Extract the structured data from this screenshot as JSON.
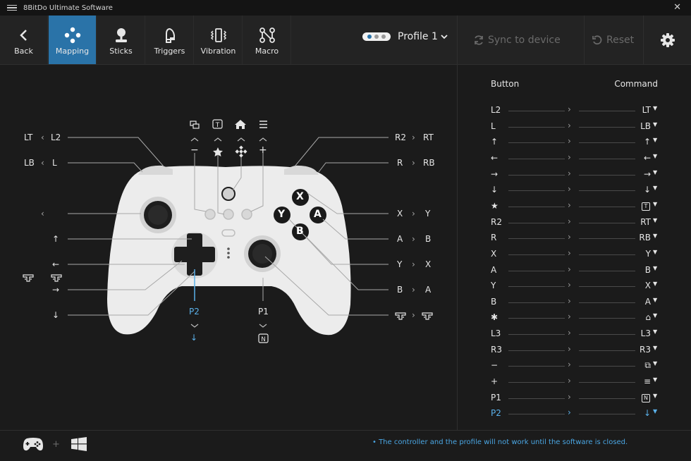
{
  "window": {
    "title": "8BitDo Ultimate Software"
  },
  "toolbar": {
    "nav": [
      {
        "id": "back",
        "label": "Back",
        "icon": "back-arrow-icon"
      },
      {
        "id": "mapping",
        "label": "Mapping",
        "icon": "mapping-dpad-icon",
        "active": true
      },
      {
        "id": "sticks",
        "label": "Sticks",
        "icon": "joystick-icon"
      },
      {
        "id": "triggers",
        "label": "Triggers",
        "icon": "trigger-icon"
      },
      {
        "id": "vibration",
        "label": "Vibration",
        "icon": "vibration-icon"
      },
      {
        "id": "macro",
        "label": "Macro",
        "icon": "macro-icon"
      }
    ],
    "profile_name": "Profile 1",
    "sync_label": "Sync to device",
    "reset_label": "Reset"
  },
  "controller": {
    "left_labels": [
      {
        "from": "LT",
        "to": "L2"
      },
      {
        "from": "LB",
        "to": "L"
      },
      {
        "from": "L3",
        "to": "L3",
        "icon": "left-stick-press-icon"
      },
      {
        "from": "",
        "to": "↑"
      },
      {
        "from": "",
        "to": "←"
      },
      {
        "from": "",
        "to": "→"
      },
      {
        "from": "",
        "to": "↓"
      }
    ],
    "right_labels": [
      {
        "from": "R2",
        "to": "RT"
      },
      {
        "from": "R",
        "to": "RB"
      },
      {
        "from": "X",
        "to": "Y"
      },
      {
        "from": "A",
        "to": "B"
      },
      {
        "from": "Y",
        "to": "X"
      },
      {
        "from": "B",
        "to": "A"
      },
      {
        "from": "R3",
        "to": "R3",
        "icon": "right-stick-press-icon"
      }
    ],
    "face_buttons": {
      "x": "X",
      "y": "Y",
      "a": "A",
      "b": "B"
    },
    "top_minus": "−",
    "top_plus": "+",
    "top_t": "T",
    "p2_label": "P2",
    "p2_arrow": "↓",
    "p1_label": "P1",
    "p1_badge": "N"
  },
  "panel": {
    "header_button": "Button",
    "header_command": "Command",
    "rows": [
      {
        "button": "L2",
        "command": "LT"
      },
      {
        "button": "L",
        "command": "LB"
      },
      {
        "button": "↑",
        "command": "↑"
      },
      {
        "button": "←",
        "command": "←"
      },
      {
        "button": "→",
        "command": "→"
      },
      {
        "button": "↓",
        "command": "↓"
      },
      {
        "button": "★",
        "command": "T",
        "command_boxed": true
      },
      {
        "button": "R2",
        "command": "RT"
      },
      {
        "button": "R",
        "command": "RB"
      },
      {
        "button": "X",
        "command": "Y"
      },
      {
        "button": "A",
        "command": "B"
      },
      {
        "button": "Y",
        "command": "X"
      },
      {
        "button": "B",
        "command": "A"
      },
      {
        "button": "✱",
        "command": "⌂",
        "button_icon": "checker-icon",
        "command_icon": "home-icon"
      },
      {
        "button": "L3",
        "command": "L3",
        "button_icon": "left-stick-press-icon",
        "command_icon": "left-stick-press-icon"
      },
      {
        "button": "R3",
        "command": "R3",
        "button_icon": "right-stick-press-icon",
        "command_icon": "right-stick-press-icon"
      },
      {
        "button": "−",
        "command": "⧉",
        "command_icon": "view-icon"
      },
      {
        "button": "+",
        "command": "≡",
        "command_icon": "menu-icon"
      },
      {
        "button": "P1",
        "command": "N",
        "command_boxed": true
      },
      {
        "button": "P2",
        "command": "↓",
        "highlighted": true
      }
    ]
  },
  "footer": {
    "note": "• The controller and the profile will not work until the software is closed."
  },
  "colors": {
    "accent": "#2a73a8",
    "highlight": "#5bb1ea",
    "background": "#1b1b1b",
    "toolbar": "#232323"
  }
}
